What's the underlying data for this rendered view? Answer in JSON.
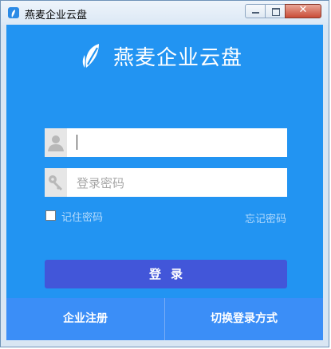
{
  "window": {
    "title": "燕麦企业云盘",
    "controls": {
      "minimize": "minimize",
      "maximize": "maximize",
      "close": "✕"
    }
  },
  "brand": {
    "name": "燕麦企业云盘",
    "logo_icon": "leaf-icon"
  },
  "login": {
    "username": {
      "value": "",
      "placeholder": "",
      "icon": "user-icon"
    },
    "password": {
      "value": "",
      "placeholder": "登录密码",
      "icon": "key-icon"
    },
    "remember_label": "记住密码",
    "remember_checked": false,
    "forgot_label": "忘记密码",
    "submit_label": "登录"
  },
  "footer": {
    "register_label": "企业注册",
    "switch_label": "切换登录方式"
  },
  "colors": {
    "panel": "#2294f2",
    "login_button": "#4256d9",
    "footer": "#3b8ef7"
  }
}
